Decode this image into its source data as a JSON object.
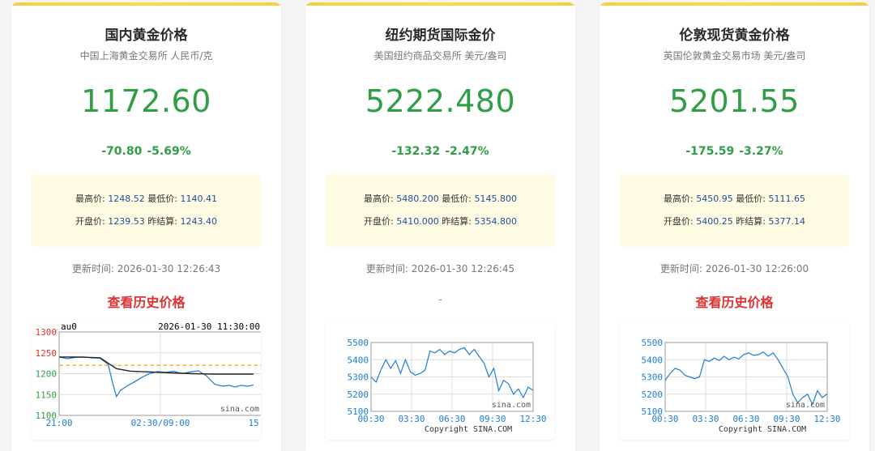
{
  "cards": [
    {
      "title": "国内黄金价格",
      "subtitle": "中国上海黄金交易所 人民币/克",
      "price": "1172.60",
      "change": "-70.80",
      "change_pct": "-5.69%",
      "high_label": "最高价:",
      "high": "1248.52",
      "low_label": "最低价:",
      "low": "1140.41",
      "open_label": "开盘价:",
      "open": "1239.53",
      "prev_label": "昨结算:",
      "prev": "1243.40",
      "updated": "更新时间: 2026-01-30 12:26:43",
      "history_link": "查看历史价格"
    },
    {
      "title": "纽约期货国际金价",
      "subtitle": "美国纽约商品交易所 美元/盎司",
      "price": "5222.480",
      "change": "-132.32",
      "change_pct": "-2.47%",
      "high_label": "最高价:",
      "high": "5480.200",
      "low_label": "最低价:",
      "low": "5145.800",
      "open_label": "开盘价:",
      "open": "5410.000",
      "prev_label": "昨结算:",
      "prev": "5354.800",
      "updated": "更新时间: 2026-01-30 12:26:45",
      "history_placeholder": "-"
    },
    {
      "title": "伦敦现货黄金价格",
      "subtitle": "英国伦敦黄金交易市场 美元/盎司",
      "price": "5201.55",
      "change": "-175.59",
      "change_pct": "-3.27%",
      "high_label": "最高价:",
      "high": "5450.95",
      "low_label": "最低价:",
      "low": "5111.65",
      "open_label": "开盘价:",
      "open": "5400.25",
      "prev_label": "昨结算:",
      "prev": "5377.14",
      "updated": "更新时间: 2026-01-30 12:26:00",
      "history_link": "查看历史价格"
    }
  ],
  "colors": {
    "up_down": "#2f9e44",
    "link": "#e03131",
    "value": "#1d4f9c",
    "accent": "#f3d04a"
  },
  "chart_data": [
    {
      "type": "line",
      "header_left": "au0",
      "header_right": "2026-01-30 11:30:00",
      "watermark": "sina.com",
      "yticks": [
        "1300",
        "1250",
        "1200",
        "1150",
        "1100"
      ],
      "ylim": [
        1100,
        1300
      ],
      "xticks": [
        "21:00",
        "02:30/09:00",
        "15:00"
      ],
      "reference_line": 1220,
      "series": [
        {
          "x": [
            0,
            8,
            16,
            24,
            32,
            40,
            48,
            52,
            56,
            60,
            66,
            72,
            80,
            88,
            96,
            104,
            112,
            120,
            128,
            136,
            144,
            152,
            160,
            166,
            172,
            178,
            184,
            190
          ],
          "values": [
            1240,
            1236,
            1239,
            1240,
            1238,
            1237,
            1222,
            1180,
            1145,
            1160,
            1170,
            1178,
            1190,
            1200,
            1205,
            1203,
            1206,
            1200,
            1204,
            1207,
            1195,
            1175,
            1170,
            1172,
            1168,
            1172,
            1170,
            1173
          ]
        },
        {
          "x": [
            0,
            20,
            40,
            48,
            56,
            70,
            90,
            110,
            130,
            150,
            170,
            190
          ],
          "values": [
            1240,
            1240,
            1238,
            1225,
            1212,
            1206,
            1204,
            1202,
            1200,
            1199,
            1199,
            1199
          ]
        }
      ]
    },
    {
      "type": "line",
      "yticks": [
        "5500",
        "5400",
        "5300",
        "5200",
        "5100"
      ],
      "ylim": [
        5100,
        5500
      ],
      "xticks": [
        "00:30",
        "03:30",
        "06:30",
        "09:30",
        "12:30"
      ],
      "watermark": "sina.com",
      "copyright": "Copyright SINA.COM",
      "series": [
        {
          "x": [
            0,
            6,
            12,
            18,
            24,
            30,
            36,
            42,
            48,
            54,
            60,
            66,
            72,
            78,
            84,
            90,
            96,
            102,
            108,
            114,
            120,
            126,
            132,
            138,
            144,
            150,
            156,
            162,
            168,
            174,
            180,
            186,
            192,
            198
          ],
          "values": [
            5300,
            5270,
            5340,
            5400,
            5350,
            5395,
            5320,
            5400,
            5330,
            5310,
            5320,
            5340,
            5450,
            5440,
            5460,
            5430,
            5450,
            5440,
            5460,
            5470,
            5430,
            5460,
            5420,
            5380,
            5300,
            5350,
            5220,
            5280,
            5260,
            5200,
            5230,
            5180,
            5240,
            5222
          ]
        }
      ]
    },
    {
      "type": "line",
      "yticks": [
        "5500",
        "5400",
        "5300",
        "5200",
        "5100"
      ],
      "ylim": [
        5100,
        5500
      ],
      "xticks": [
        "00:30",
        "03:30",
        "06:30",
        "09:30",
        "12:30"
      ],
      "watermark": "sina.com",
      "copyright": "Copyright SINA.COM",
      "series": [
        {
          "x": [
            0,
            6,
            12,
            18,
            24,
            30,
            36,
            42,
            48,
            54,
            60,
            66,
            72,
            78,
            84,
            90,
            96,
            102,
            108,
            114,
            120,
            126,
            132,
            138,
            144,
            150,
            156,
            162,
            168,
            174,
            180,
            186,
            192,
            198
          ],
          "values": [
            5280,
            5320,
            5350,
            5340,
            5310,
            5300,
            5290,
            5300,
            5400,
            5390,
            5410,
            5395,
            5420,
            5400,
            5415,
            5405,
            5430,
            5440,
            5425,
            5430,
            5445,
            5420,
            5440,
            5400,
            5350,
            5300,
            5200,
            5150,
            5180,
            5200,
            5140,
            5220,
            5180,
            5201
          ]
        }
      ]
    }
  ]
}
